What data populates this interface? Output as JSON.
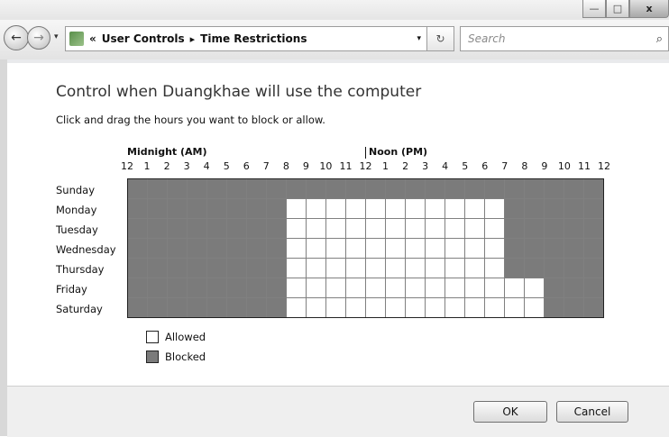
{
  "window": {
    "buttons": {
      "minimize": "—",
      "maximize": "□",
      "close": "x"
    }
  },
  "nav": {
    "back_icon": "←",
    "forward_icon": "→",
    "dropdown_icon": "▾",
    "breadcrumb_prefix": "«",
    "breadcrumb": [
      "User Controls",
      "Time Restrictions"
    ],
    "separator": "▸",
    "refresh_icon": "↻",
    "search_placeholder": "Search",
    "search_icon": "⌕"
  },
  "main": {
    "heading": "Control when Duangkhae will use the computer",
    "instructions": "Click and drag the hours you want to block or allow.",
    "midnight_label": "Midnight (AM)",
    "noon_label": "Noon (PM)",
    "hours": [
      "12",
      "1",
      "2",
      "3",
      "4",
      "5",
      "6",
      "7",
      "8",
      "9",
      "10",
      "11",
      "12",
      "1",
      "2",
      "3",
      "4",
      "5",
      "6",
      "7",
      "8",
      "9",
      "10",
      "11",
      "12"
    ],
    "days": [
      "Sunday",
      "Monday",
      "Tuesday",
      "Wednesday",
      "Thursday",
      "Friday",
      "Saturday"
    ],
    "grid_blocked": [
      [
        1,
        1,
        1,
        1,
        1,
        1,
        1,
        1,
        1,
        1,
        1,
        1,
        1,
        1,
        1,
        1,
        1,
        1,
        1,
        1,
        1,
        1,
        1,
        1
      ],
      [
        1,
        1,
        1,
        1,
        1,
        1,
        1,
        1,
        0,
        0,
        0,
        0,
        0,
        0,
        0,
        0,
        0,
        0,
        0,
        1,
        1,
        1,
        1,
        1
      ],
      [
        1,
        1,
        1,
        1,
        1,
        1,
        1,
        1,
        0,
        0,
        0,
        0,
        0,
        0,
        0,
        0,
        0,
        0,
        0,
        1,
        1,
        1,
        1,
        1
      ],
      [
        1,
        1,
        1,
        1,
        1,
        1,
        1,
        1,
        0,
        0,
        0,
        0,
        0,
        0,
        0,
        0,
        0,
        0,
        0,
        1,
        1,
        1,
        1,
        1
      ],
      [
        1,
        1,
        1,
        1,
        1,
        1,
        1,
        1,
        0,
        0,
        0,
        0,
        0,
        0,
        0,
        0,
        0,
        0,
        0,
        1,
        1,
        1,
        1,
        1
      ],
      [
        1,
        1,
        1,
        1,
        1,
        1,
        1,
        1,
        0,
        0,
        0,
        0,
        0,
        0,
        0,
        0,
        0,
        0,
        0,
        0,
        0,
        1,
        1,
        1
      ],
      [
        1,
        1,
        1,
        1,
        1,
        1,
        1,
        1,
        0,
        0,
        0,
        0,
        0,
        0,
        0,
        0,
        0,
        0,
        0,
        0,
        0,
        1,
        1,
        1
      ]
    ],
    "legend": {
      "allowed": "Allowed",
      "blocked": "Blocked"
    },
    "colors": {
      "allowed": "#ffffff",
      "blocked": "#7b7b7b"
    }
  },
  "footer": {
    "ok_label": "OK",
    "cancel_label": "Cancel"
  }
}
